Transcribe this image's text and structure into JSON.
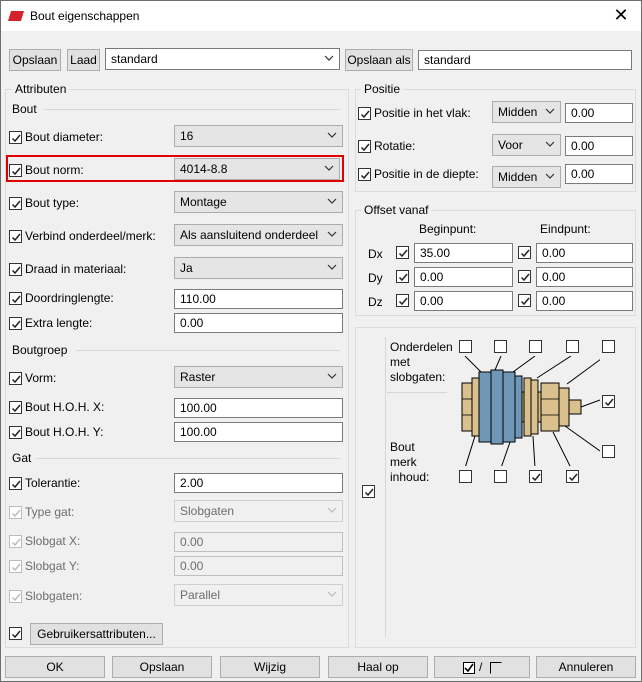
{
  "window": {
    "title": "Bout eigenschappen",
    "close_glyph": "✕"
  },
  "toolbar": {
    "save_label": "Opslaan",
    "load_label": "Laad",
    "preset_value": "standard",
    "save_as_label": "Opslaan als",
    "save_as_value": "standard"
  },
  "attributes": {
    "group_label": "Attributen",
    "bout_section": "Bout",
    "diameter": {
      "label": "Bout diameter:",
      "value": "16"
    },
    "norm": {
      "label": "Bout norm:",
      "value": "4014-8.8"
    },
    "type": {
      "label": "Bout type:",
      "value": "Montage"
    },
    "connect": {
      "label": "Verbind onderdeel/merk:",
      "value": "Als aansluitend onderdeel"
    },
    "thread": {
      "label": "Draad in materiaal:",
      "value": "Ja"
    },
    "penetration": {
      "label": "Doordringlengte:",
      "value": "110.00"
    },
    "extra": {
      "label": "Extra lengte:",
      "value": "0.00"
    },
    "group_section": "Boutgroep",
    "shape": {
      "label": "Vorm:",
      "value": "Raster"
    },
    "hoh_x": {
      "label": "Bout H.O.H. X:",
      "value": "100.00"
    },
    "hoh_y": {
      "label": "Bout H.O.H. Y:",
      "value": "100.00"
    },
    "gat_section": "Gat",
    "tolerance": {
      "label": "Tolerantie:",
      "value": "2.00"
    },
    "hole_type": {
      "label": "Type gat:",
      "value": "Slobgaten"
    },
    "slot_x": {
      "label": "Slobgat X:",
      "value": "0.00"
    },
    "slot_y": {
      "label": "Slobgat Y:",
      "value": "0.00"
    },
    "slots": {
      "label": "Slobgaten:",
      "value": "Parallel"
    },
    "user_attrs_label": "Gebruikersattributen..."
  },
  "position": {
    "group_label": "Positie",
    "plane": {
      "label": "Positie in het vlak:",
      "value": "Midden",
      "offset": "0.00"
    },
    "rotation": {
      "label": "Rotatie:",
      "value": "Voor",
      "offset": "0.00"
    },
    "depth": {
      "label": "Positie in de diepte:",
      "value": "Midden",
      "offset": "0.00"
    }
  },
  "offset": {
    "group_label": "Offset vanaf",
    "start_header": "Beginpunt:",
    "end_header": "Eindpunt:",
    "rows": [
      {
        "label": "Dx",
        "start": "35.00",
        "end": "0.00"
      },
      {
        "label": "Dy",
        "start": "0.00",
        "end": "0.00"
      },
      {
        "label": "Dz",
        "start": "0.00",
        "end": "0.00"
      }
    ]
  },
  "diagram": {
    "parts_label_1": "Onderdelen",
    "parts_label_2": "met",
    "parts_label_3": "slobgaten:",
    "assembly_label_1": "Bout",
    "assembly_label_2": "merk",
    "assembly_label_3": "inhoud:"
  },
  "footer": {
    "ok_label": "OK",
    "save_label": "Opslaan",
    "modify_label": "Wijzig",
    "get_label": "Haal op",
    "toggle_slash": "/",
    "cancel_label": "Annuleren"
  },
  "colors": {
    "highlight": "#e00000",
    "bolt_shaft": "#6f98b8",
    "bolt_nut": "#d9c08c",
    "app_icon": "#d6212a"
  }
}
